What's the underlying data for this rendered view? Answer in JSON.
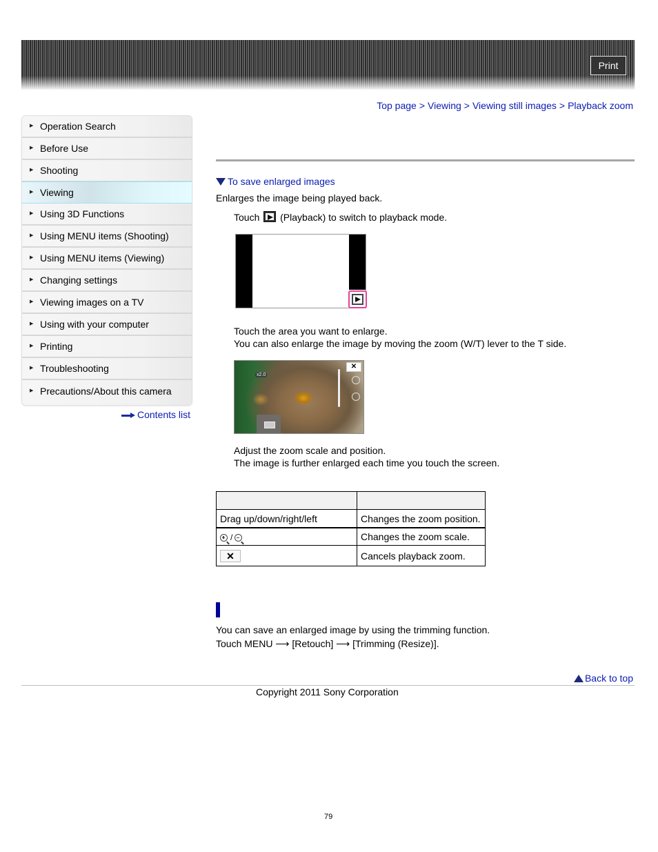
{
  "header": {
    "print_label": "Print"
  },
  "breadcrumb": {
    "items": [
      "Top page",
      "Viewing",
      "Viewing still images",
      "Playback zoom"
    ],
    "separator": ">"
  },
  "sidebar": {
    "items": [
      {
        "label": "Operation Search",
        "active": false
      },
      {
        "label": "Before Use",
        "active": false
      },
      {
        "label": "Shooting",
        "active": false
      },
      {
        "label": "Viewing",
        "active": true
      },
      {
        "label": "Using 3D Functions",
        "active": false
      },
      {
        "label": "Using MENU items (Shooting)",
        "active": false
      },
      {
        "label": "Using MENU items (Viewing)",
        "active": false
      },
      {
        "label": "Changing settings",
        "active": false
      },
      {
        "label": "Viewing images on a TV",
        "active": false
      },
      {
        "label": "Using with your computer",
        "active": false
      },
      {
        "label": "Printing",
        "active": false
      },
      {
        "label": "Troubleshooting",
        "active": false
      },
      {
        "label": "Precautions/About this camera",
        "active": false
      }
    ],
    "contents_link": "Contents list"
  },
  "main": {
    "anchor_link": "To save enlarged images",
    "intro": "Enlarges the image being played back.",
    "step1": {
      "before_icon": "Touch",
      "icon": "playback-icon",
      "after_icon": "(Playback) to switch to playback mode."
    },
    "step2": {
      "line1": "Touch the area you want to enlarge.",
      "line2": "You can also enlarge the image by moving the zoom (W/T) lever to the T side."
    },
    "screen2_label": "x2.0",
    "step3": {
      "line1": "Adjust the zoom scale and position.",
      "line2": "The image is further enlarged each time you touch the screen."
    },
    "table": {
      "headers": [
        "",
        ""
      ],
      "rows": [
        {
          "control": "Drag up/down/right/left",
          "description": "Changes the zoom position."
        },
        {
          "control_icons": [
            "zoom-in-icon",
            "zoom-out-icon"
          ],
          "control_separator": "/",
          "description": "Changes the zoom scale."
        },
        {
          "control_icons": [
            "close-icon"
          ],
          "control_glyph": "✕",
          "description": "Cancels playback zoom."
        }
      ]
    },
    "save_section": {
      "line1": "You can save an enlarged image by using the trimming function.",
      "line2_parts": [
        "Touch MENU",
        "[Retouch]",
        "[Trimming (Resize)]."
      ],
      "arrow": "⟶"
    }
  },
  "footer": {
    "back_to_top": "Back to top",
    "copyright": "Copyright 2011 Sony Corporation",
    "page_number": "79"
  },
  "colors": {
    "link": "#0a1bb0",
    "section_bar": "#000099",
    "active_nav": "#dff7fb",
    "highlight_pink": "#e8409a"
  }
}
